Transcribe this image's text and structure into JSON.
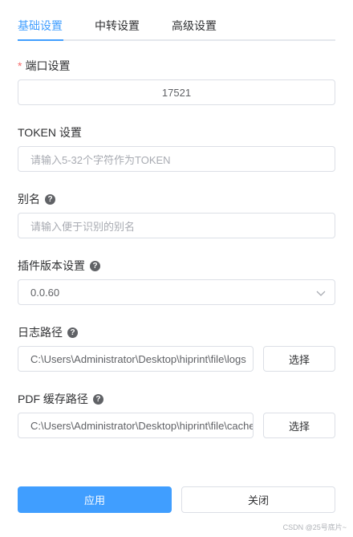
{
  "tabs": [
    {
      "label": "基础设置",
      "active": true
    },
    {
      "label": "中转设置",
      "active": false
    },
    {
      "label": "高级设置",
      "active": false
    }
  ],
  "fields": {
    "port": {
      "label": "端口设置",
      "required_mark": "*",
      "value": "17521"
    },
    "token": {
      "label": "TOKEN 设置",
      "placeholder": "请输入5-32个字符作为TOKEN"
    },
    "alias": {
      "label": "别名",
      "placeholder": "请输入便于识别的别名"
    },
    "plugin_version": {
      "label": "插件版本设置",
      "value": "0.0.60"
    },
    "log_path": {
      "label": "日志路径",
      "value": "C:\\Users\\Administrator\\Desktop\\hiprint\\file\\logs",
      "select_label": "选择"
    },
    "pdf_cache_path": {
      "label": "PDF 缓存路径",
      "value": "C:\\Users\\Administrator\\Desktop\\hiprint\\file\\cache",
      "select_label": "选择"
    }
  },
  "help_icon_text": "?",
  "footer": {
    "apply_label": "应用",
    "close_label": "关闭"
  },
  "watermark": "CSDN @25号底片~",
  "colors": {
    "accent": "#409eff",
    "required": "#f56c6c",
    "border": "#dcdfe6"
  }
}
